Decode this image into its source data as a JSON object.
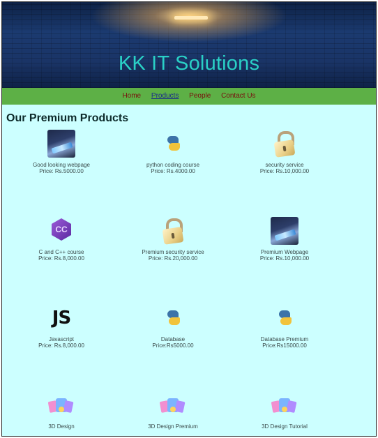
{
  "site": {
    "title": "KK IT Solutions"
  },
  "nav": {
    "items": [
      "Home",
      "Products",
      "People",
      "Contact Us"
    ],
    "active": "Products"
  },
  "section": {
    "title": "Our Premium Products"
  },
  "products": [
    {
      "name": "Good looking webpage",
      "price": "Price: Rs.5000.00",
      "icon": "webpage-icon"
    },
    {
      "name": "python coding course",
      "price": "Price: Rs.4000.00",
      "icon": "python-icon"
    },
    {
      "name": "security service",
      "price": "Price: Rs.10,000.00",
      "icon": "lock-icon"
    },
    {
      "name": "C and C++ course",
      "price": "Price: Rs.8,000.00",
      "icon": "cpp-icon"
    },
    {
      "name": "Premium security service",
      "price": "Price: Rs.20,000.00",
      "icon": "lock-icon"
    },
    {
      "name": "Premium Webpage",
      "price": "Price: Rs.10,000.00",
      "icon": "webpage-icon"
    },
    {
      "name": "Javascript",
      "price": "Price: Rs.8,000.00",
      "icon": "javascript-icon",
      "icon_text": "JS"
    },
    {
      "name": "Database",
      "price": "Price:Rs5000.00",
      "icon": "python-icon"
    },
    {
      "name": "Database Premium",
      "price": "Price:Rs15000.00",
      "icon": "python-icon"
    },
    {
      "name": "3D Design",
      "price": "",
      "icon": "3d-design-icon"
    },
    {
      "name": "3D Design Premium",
      "price": "",
      "icon": "3d-design-icon"
    },
    {
      "name": "3D Design Tutorial",
      "price": "",
      "icon": "3d-design-icon"
    }
  ]
}
